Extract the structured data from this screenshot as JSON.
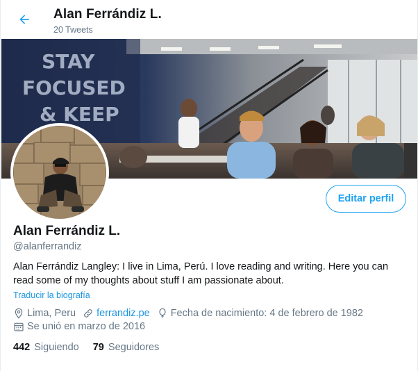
{
  "header": {
    "back_icon": "arrow-left-icon",
    "title": "Alan Ferrándiz L.",
    "tweet_count": "20 Tweets"
  },
  "banner": {
    "wall_text_lines": [
      "STAY",
      "FOCUSED",
      "& KEEP"
    ]
  },
  "profile": {
    "edit_label": "Editar perfil",
    "name": "Alan Ferrándiz L.",
    "handle": "@alanferrandiz",
    "bio": "Alan Ferrándiz Langley: I live in Lima, Perú. I love reading and writing. Here you can read some of my thoughts about stuff I am passionate about.",
    "translate_label": "Traducir la biografía",
    "location": "Lima, Peru",
    "website": "ferrandiz.pe",
    "birthday": "Fecha de nacimiento: 4 de febrero de 1982",
    "joined": "Se unió en marzo de 2016",
    "following_count": "442",
    "following_label": "Siguiendo",
    "followers_count": "79",
    "followers_label": "Seguidores"
  },
  "colors": {
    "accent": "#1da1f2",
    "link": "#1b95e0",
    "secondary_text": "#657786"
  }
}
